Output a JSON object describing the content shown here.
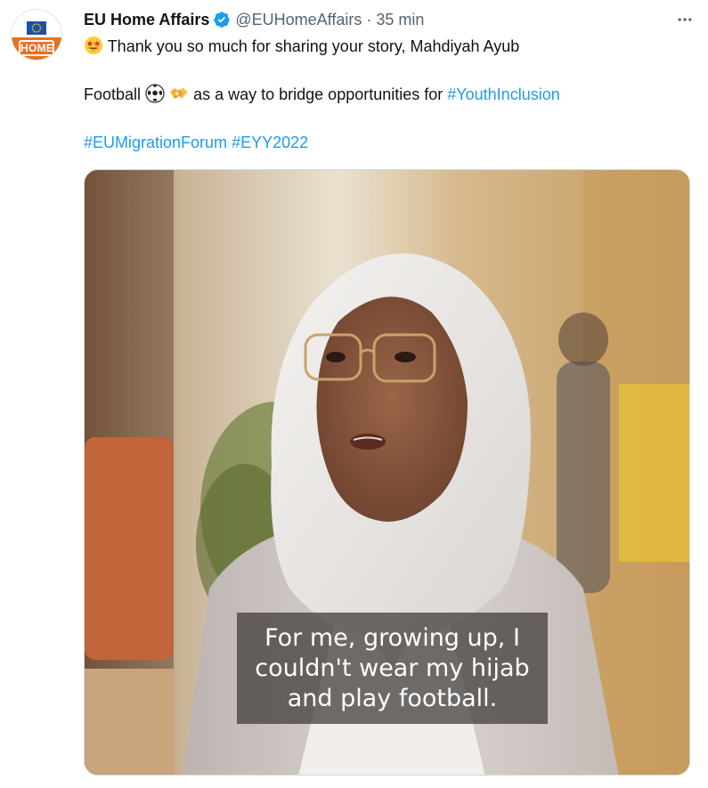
{
  "account": {
    "display_name": "EU Home Affairs",
    "handle": "@EUHomeAffairs",
    "separator": "·",
    "time": "35 min",
    "verified": true,
    "avatar_label": "HOME",
    "avatar_colors": {
      "orange": "#e8701f",
      "flag_blue": "#1d4fa6",
      "stars": "#ffdd00"
    }
  },
  "tweet": {
    "line1_emoji": "star-struck-emoji",
    "line1_text": "Thank you so much for sharing your story, Mahdiyah Ayub",
    "line2_prefix": "Football",
    "line2_emojis": [
      "soccer-ball-emoji",
      "handshake-emoji"
    ],
    "line2_text": "as a way to bridge opportunities for",
    "line2_hashtag": "#YouthInclusion",
    "hashtags": [
      "#EUMigrationForum",
      "#EYY2022"
    ]
  },
  "media": {
    "type": "video",
    "subtitle_lines": [
      "For me, growing up, I",
      "couldn't wear my hijab",
      "and play football."
    ]
  },
  "icons": {
    "more": "more-options-icon",
    "verified": "verified-badge-icon"
  },
  "colors": {
    "link": "#1d9bf0",
    "text": "#0f1419",
    "secondary": "#536471",
    "verified": "#1d9bf0"
  }
}
